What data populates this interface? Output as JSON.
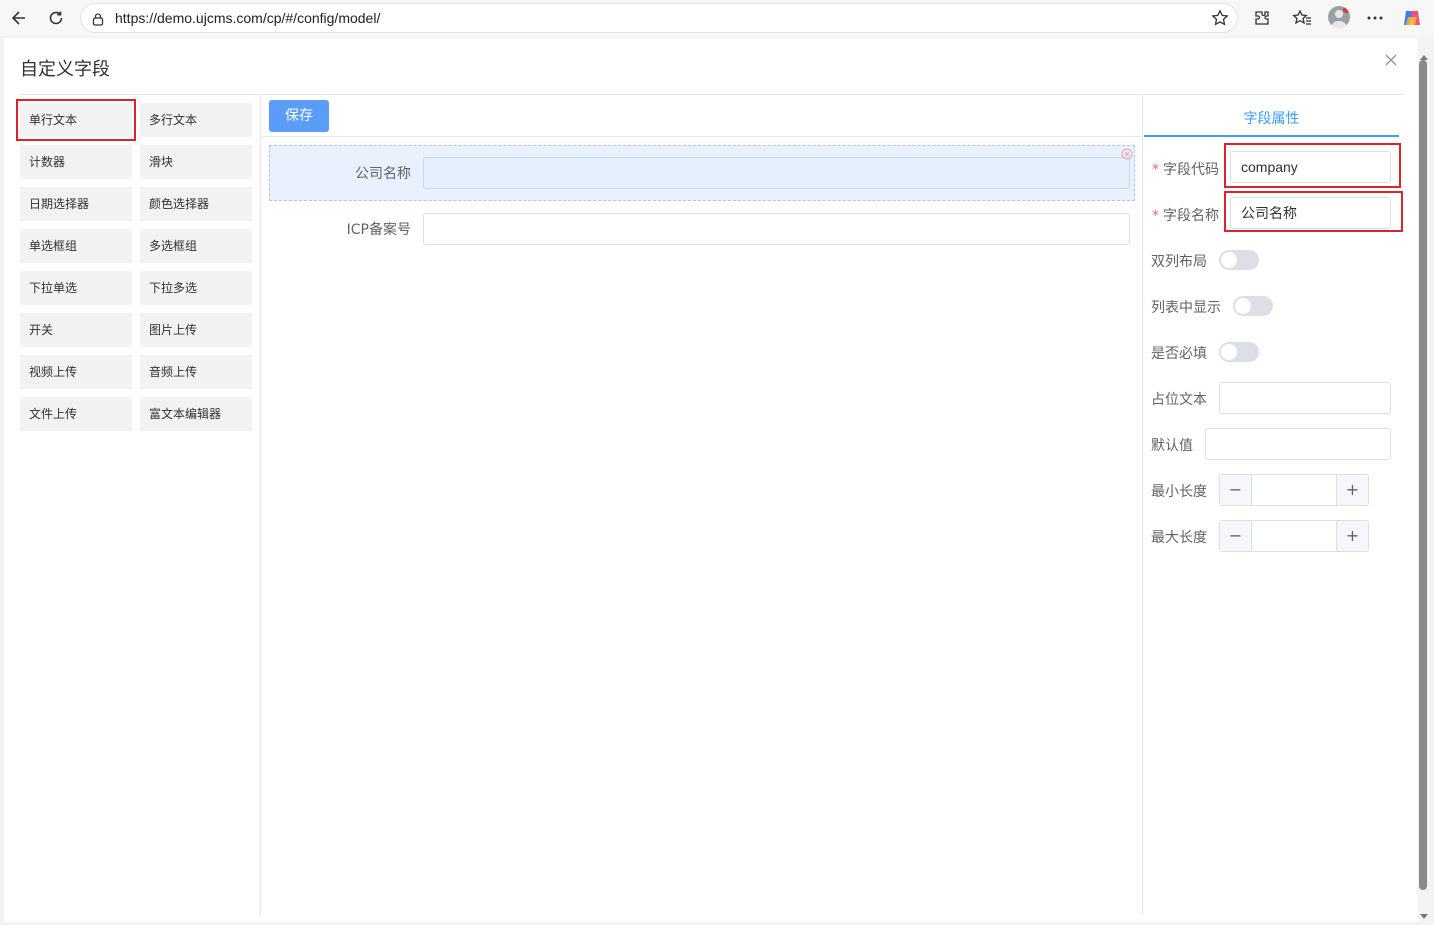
{
  "browser": {
    "url": "https://demo.ujcms.com/cp/#/config/model/"
  },
  "dialog": {
    "title": "自定义字段"
  },
  "palette": {
    "items": [
      {
        "label": "单行文本"
      },
      {
        "label": "多行文本"
      },
      {
        "label": "计数器"
      },
      {
        "label": "滑块"
      },
      {
        "label": "日期选择器"
      },
      {
        "label": "颜色选择器"
      },
      {
        "label": "单选框组"
      },
      {
        "label": "多选框组"
      },
      {
        "label": "下拉单选"
      },
      {
        "label": "下拉多选"
      },
      {
        "label": "开关"
      },
      {
        "label": "图片上传"
      },
      {
        "label": "视频上传"
      },
      {
        "label": "音频上传"
      },
      {
        "label": "文件上传"
      },
      {
        "label": "富文本编辑器"
      }
    ]
  },
  "center": {
    "save_label": "保存",
    "fields": [
      {
        "label": "公司名称",
        "value": ""
      },
      {
        "label": "ICP备案号",
        "value": ""
      }
    ]
  },
  "props": {
    "tab_label": "字段属性",
    "required_mark": "*",
    "code_label": "字段代码",
    "code_value": "company",
    "name_label": "字段名称",
    "name_value": "公司名称",
    "double_column_label": "双列布局",
    "show_in_list_label": "列表中显示",
    "required_label": "是否必填",
    "placeholder_label": "占位文本",
    "placeholder_value": "",
    "default_label": "默认值",
    "default_value": "",
    "min_length_label": "最小长度",
    "max_length_label": "最大长度",
    "minus": "−",
    "plus": "+",
    "toggles": {
      "double_column": false,
      "show_in_list": false,
      "required": false
    }
  },
  "colors": {
    "primary": "#409eff",
    "save_button": "#5a9cf8",
    "highlight": "#d9232d",
    "active_row": "#e8f1fd"
  }
}
